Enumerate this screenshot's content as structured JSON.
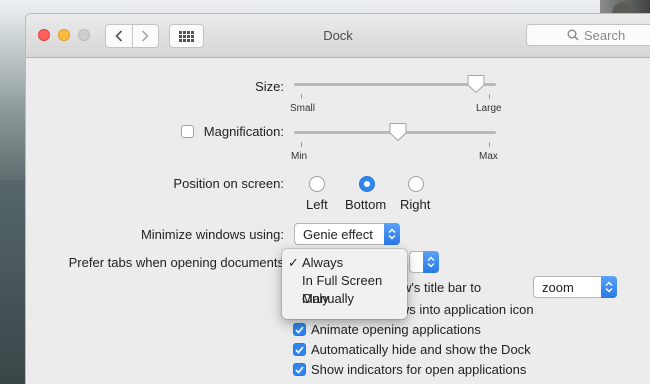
{
  "window": {
    "title": "Dock"
  },
  "toolbar": {
    "search_placeholder": "Search"
  },
  "size": {
    "label": "Size:",
    "min_label": "Small",
    "max_label": "Large",
    "value_fraction": 0.9
  },
  "magnification": {
    "label": "Magnification:",
    "checked": false,
    "min_label": "Min",
    "max_label": "Max",
    "value_fraction": 0.52
  },
  "position": {
    "label": "Position on screen:",
    "options": [
      "Left",
      "Bottom",
      "Right"
    ],
    "selected": "Bottom"
  },
  "minimize": {
    "label": "Minimize windows using:",
    "value": "Genie effect"
  },
  "prefer_tabs": {
    "label": "Prefer tabs when opening documents",
    "menu_options": [
      "Always",
      "In Full Screen Only",
      "Manually"
    ],
    "selected": "Always"
  },
  "double_click": {
    "label_visible": "w's title bar to",
    "value": "zoom"
  },
  "checkboxes": [
    {
      "label": "Minimize windows into application icon",
      "checked": false
    },
    {
      "label": "Animate opening applications",
      "checked": true
    },
    {
      "label": "Automatically hide and show the Dock",
      "checked": true
    },
    {
      "label": "Show indicators for open applications",
      "checked": true
    }
  ],
  "colors": {
    "accent": "#2f86ee",
    "close": "#fc605c",
    "minimize": "#fdbc40"
  },
  "icons": [
    "back-chevron-icon",
    "forward-chevron-icon",
    "grid-icon",
    "search-icon",
    "checkmark-icon",
    "popup-arrows-icon"
  ]
}
